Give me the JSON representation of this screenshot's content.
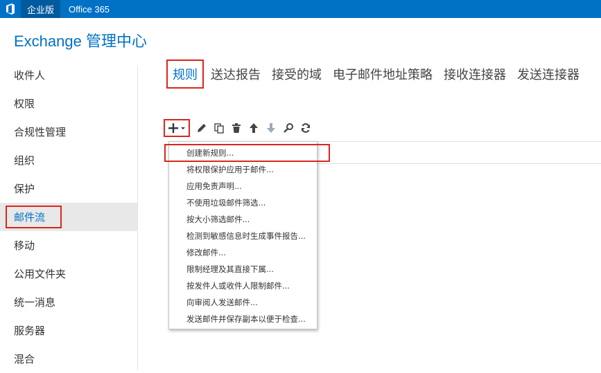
{
  "topbar": {
    "edition": "企业版",
    "product": "Office 365"
  },
  "app_title": "Exchange 管理中心",
  "sidebar": {
    "items": [
      {
        "label": "收件人"
      },
      {
        "label": "权限"
      },
      {
        "label": "合规性管理"
      },
      {
        "label": "组织"
      },
      {
        "label": "保护"
      },
      {
        "label": "邮件流"
      },
      {
        "label": "移动"
      },
      {
        "label": "公用文件夹"
      },
      {
        "label": "统一消息"
      },
      {
        "label": "服务器"
      },
      {
        "label": "混合"
      }
    ],
    "active": "邮件流"
  },
  "tabs": [
    {
      "label": "规则"
    },
    {
      "label": "送达报告"
    },
    {
      "label": "接受的域"
    },
    {
      "label": "电子邮件地址策略"
    },
    {
      "label": "接收连接器"
    },
    {
      "label": "发送连接器"
    }
  ],
  "toolbar": {
    "icons": [
      "plus-icon",
      "pencil-icon",
      "copy-icon",
      "trash-icon",
      "arrow-up-icon",
      "arrow-down-icon",
      "search-icon",
      "refresh-icon"
    ]
  },
  "menu": {
    "items": [
      {
        "label": "创建新规则..."
      },
      {
        "label": "将权限保护应用于邮件..."
      },
      {
        "label": "应用免责声明..."
      },
      {
        "label": "不使用垃圾邮件筛选..."
      },
      {
        "label": "按大小筛选邮件..."
      },
      {
        "label": "检测到敏感信息时生成事件报告..."
      },
      {
        "label": "修改邮件..."
      },
      {
        "label": "限制经理及其直接下属..."
      },
      {
        "label": "按发件人或收件人限制邮件..."
      },
      {
        "label": "向审阅人发送邮件..."
      },
      {
        "label": "发送邮件并保存副本以便于检查..."
      }
    ]
  },
  "colors": {
    "brand": "#0072c6",
    "highlight": "#d9261c"
  }
}
